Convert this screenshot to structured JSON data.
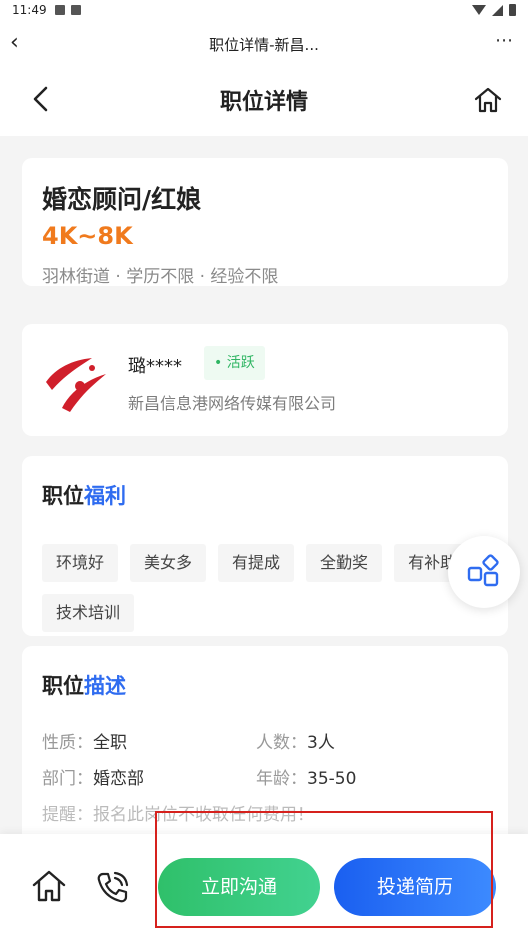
{
  "status_bar": {
    "time": "11:49"
  },
  "browser": {
    "title": "职位详情-新昌..."
  },
  "header": {
    "title": "职位详情"
  },
  "job": {
    "title": "婚恋顾问/红娘",
    "salary": "4K~8K",
    "meta": "羽林街道 · 学历不限 · 经验不限"
  },
  "company": {
    "recruiter": "璐****",
    "active_label": "• 活跃",
    "name": "新昌信息港网络传媒有限公司"
  },
  "benefits": {
    "title_prefix": "职位",
    "title_highlight": "福利",
    "tags": [
      "环境好",
      "美女多",
      "有提成",
      "全勤奖",
      "有补助",
      "技术培训"
    ]
  },
  "description": {
    "title_prefix": "职位",
    "title_highlight": "描述",
    "rows": [
      {
        "label": "性质：",
        "value": "全职"
      },
      {
        "label": "人数：",
        "value": "3人"
      },
      {
        "label": "部门：",
        "value": "婚恋部"
      },
      {
        "label": "年龄：",
        "value": "35-50"
      }
    ],
    "note": "提醒：报名此岗位不收取任何费用！"
  },
  "bottom": {
    "chat_label": "立即沟通",
    "resume_label": "投递简历"
  },
  "colors": {
    "salary": "#f07a1d",
    "accent_blue": "#2f6cf0",
    "active_green": "#2fb563",
    "highlight_red": "#d6211d"
  }
}
